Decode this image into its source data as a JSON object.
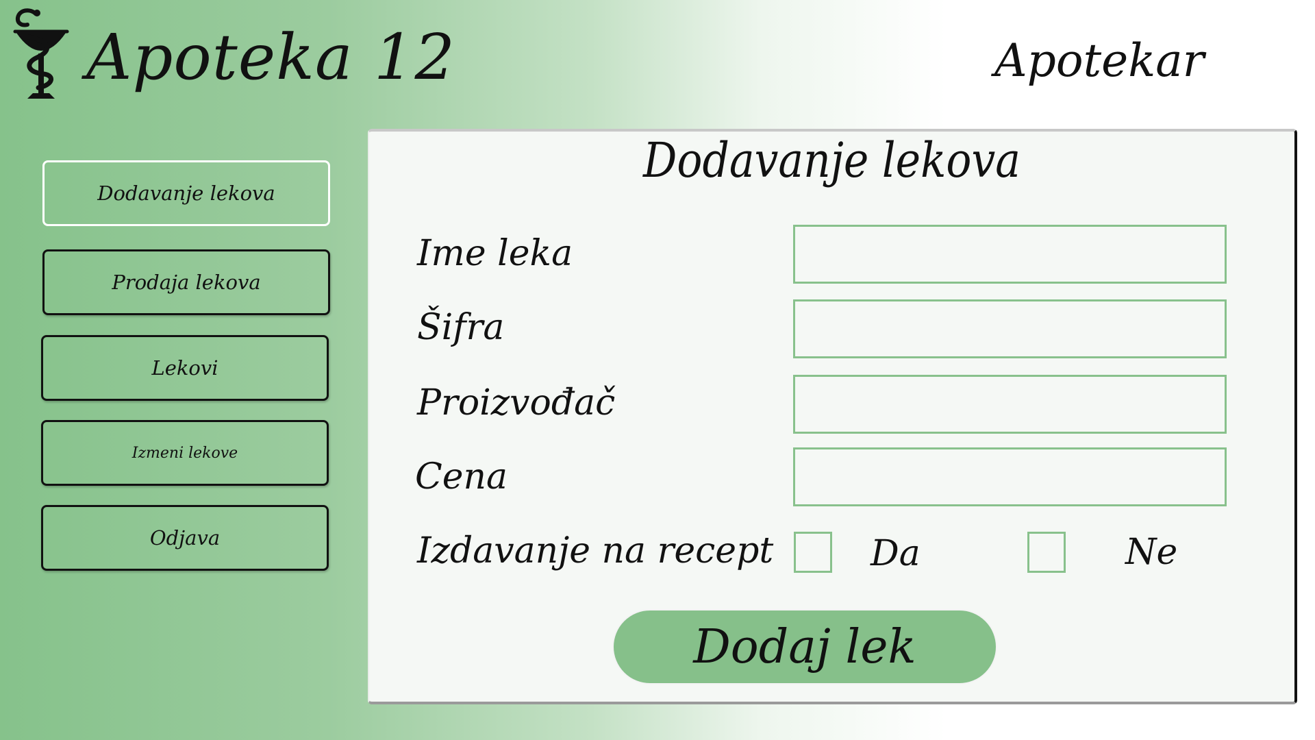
{
  "header": {
    "logo_icon": "bowl-of-hygieia-icon",
    "app_title": "Apoteka 12",
    "role": "Apotekar"
  },
  "sidebar": {
    "items": [
      {
        "label": "Dodavanje lekova",
        "active": true
      },
      {
        "label": "Prodaja lekova",
        "active": false
      },
      {
        "label": "Lekovi",
        "active": false
      },
      {
        "label": "Izmeni lekove",
        "active": false
      },
      {
        "label": "Odjava",
        "active": false
      }
    ]
  },
  "form": {
    "title": "Dodavanje lekova",
    "fields": [
      {
        "label": "Ime leka",
        "value": ""
      },
      {
        "label": "Šifra",
        "value": ""
      },
      {
        "label": "Proizvođač",
        "value": ""
      },
      {
        "label": "Cena",
        "value": ""
      }
    ],
    "prescription": {
      "label": "Izdavanje na recept",
      "yes_label": "Da",
      "no_label": "Ne",
      "yes_checked": false,
      "no_checked": false
    },
    "submit_label": "Dodaj lek"
  },
  "colors": {
    "accent_green": "#86c08a",
    "input_border": "#88c18c",
    "panel_bg": "#f5f8f5",
    "text": "#111111"
  }
}
